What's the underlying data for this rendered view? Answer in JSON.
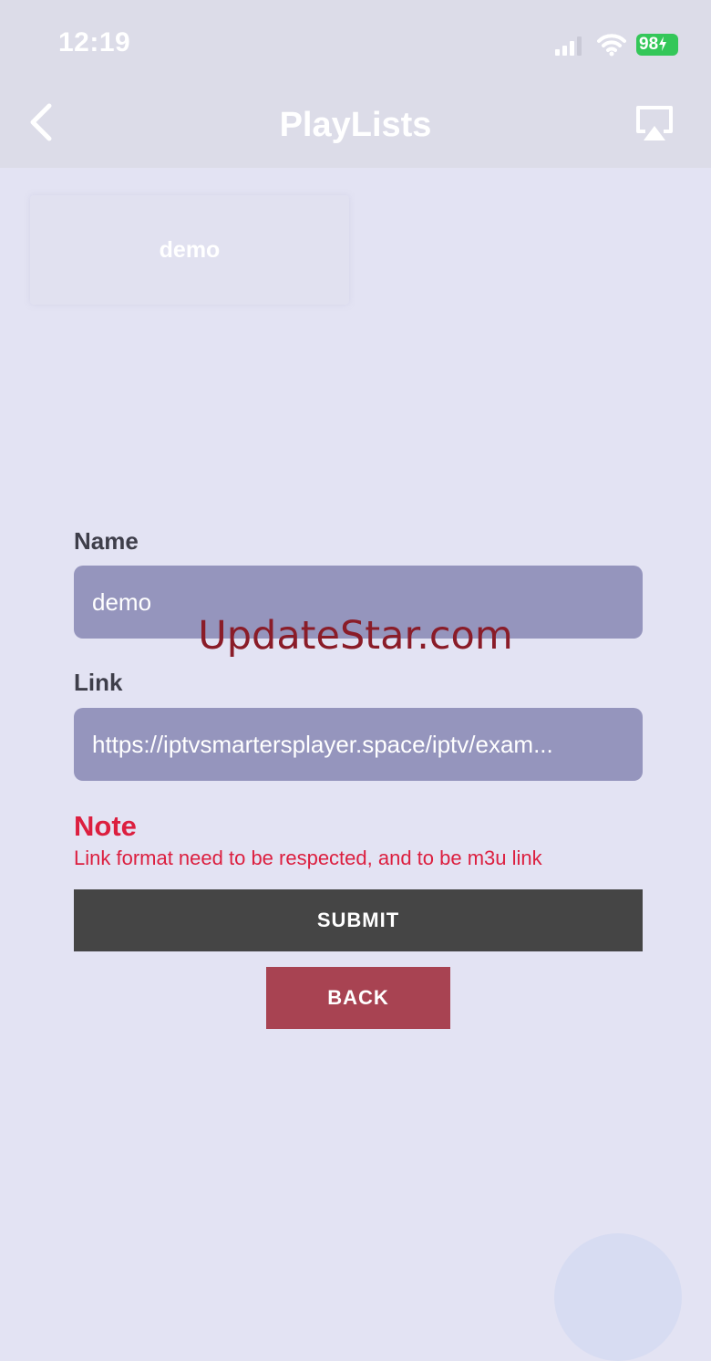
{
  "status_bar": {
    "time": "12:19",
    "battery_level": "98",
    "battery_color": "#34c759",
    "icons": [
      "signal-icon",
      "wifi-icon",
      "battery-charging-icon"
    ]
  },
  "nav": {
    "title": "PlayLists",
    "back_icon": "chevron-left-icon",
    "right_icon": "airplay-icon"
  },
  "playlists": [
    {
      "label": "demo"
    }
  ],
  "form": {
    "name_label": "Name",
    "name_value": "demo",
    "link_label": "Link",
    "link_value": "https://iptvsmartersplayer.space/iptv/exam..."
  },
  "note": {
    "title": "Note",
    "text": "Link format need to be respected, and to be m3u link",
    "color": "#dc1f3f"
  },
  "buttons": {
    "submit_label": "SUBMIT",
    "back_label": "BACK"
  },
  "watermark": "UpdateStar.com",
  "colors": {
    "background": "#e3e3f3",
    "field_bg": "#9595bd",
    "submit_bg": "#454545",
    "back_bg": "#a84352"
  }
}
